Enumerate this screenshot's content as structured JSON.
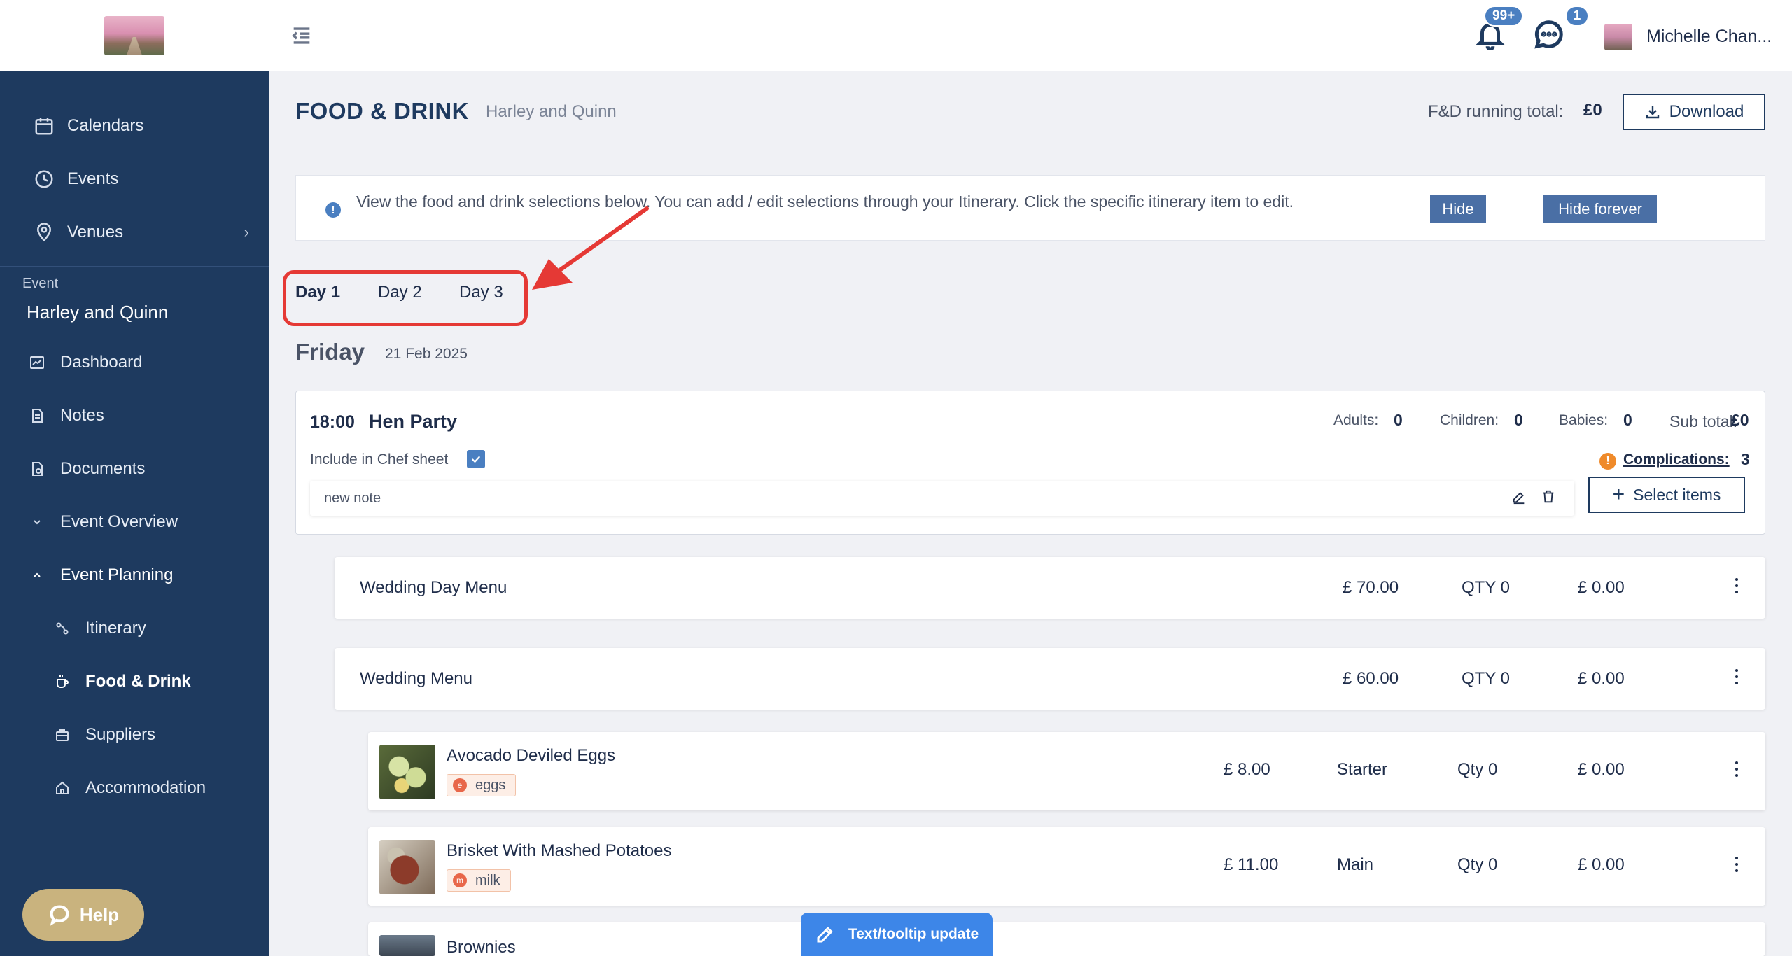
{
  "header": {
    "notifications_badge": "99+",
    "messages_badge": "1",
    "user_name": "Michelle Chan..."
  },
  "sidebar": {
    "top_items": [
      {
        "label": "Calendars",
        "icon": "calendar-icon"
      },
      {
        "label": "Events",
        "icon": "clock-icon"
      },
      {
        "label": "Venues",
        "icon": "location-pin-icon"
      }
    ],
    "event_section_label": "Event",
    "event_name": "Harley and Quinn",
    "event_items": [
      {
        "label": "Dashboard",
        "icon": "chart-icon"
      },
      {
        "label": "Notes",
        "icon": "note-icon"
      },
      {
        "label": "Documents",
        "icon": "document-icon"
      },
      {
        "label": "Event Overview",
        "icon": "chevron-down-icon"
      },
      {
        "label": "Event Planning",
        "icon": "chevron-up-icon"
      }
    ],
    "planning_items": [
      {
        "label": "Itinerary",
        "icon": "route-icon"
      },
      {
        "label": "Food & Drink",
        "icon": "coffee-cup-icon"
      },
      {
        "label": "Suppliers",
        "icon": "briefcase-icon"
      },
      {
        "label": "Accommodation",
        "icon": "home-icon"
      }
    ],
    "help_label": "Help"
  },
  "page": {
    "title": "FOOD & DRINK",
    "subtitle": "Harley and Quinn",
    "running_total_label": "F&D running total:",
    "running_total_value": "£0",
    "download_label": "Download"
  },
  "info_banner": {
    "text": "View the food and drink selections below. You can add / edit selections through your Itinerary. Click the specific itinerary item to edit.",
    "hide_label": "Hide",
    "hide_forever_label": "Hide forever"
  },
  "tabs": [
    {
      "label": "Day 1",
      "active": true
    },
    {
      "label": "Day 2",
      "active": false
    },
    {
      "label": "Day 3",
      "active": false
    }
  ],
  "day": {
    "name": "Friday",
    "date": "21 Feb 2025"
  },
  "event_item": {
    "time": "18:00",
    "title": "Hen Party",
    "adults_label": "Adults:",
    "adults_value": "0",
    "children_label": "Children:",
    "children_value": "0",
    "babies_label": "Babies:",
    "babies_value": "0",
    "subtotal_label": "Sub total:",
    "subtotal_value": "£0",
    "chef_sheet_label": "Include in Chef sheet",
    "chef_sheet_checked": true,
    "complications_label": "Complications:",
    "complications_value": "3",
    "note_text": "new note",
    "select_items_label": "Select items"
  },
  "menus": [
    {
      "name": "Wedding Day Menu",
      "price": "£ 70.00",
      "qty": "QTY 0",
      "total": "£ 0.00"
    },
    {
      "name": "Wedding Menu",
      "price": "£ 60.00",
      "qty": "QTY 0",
      "total": "£ 0.00"
    }
  ],
  "items": [
    {
      "name": "Avocado Deviled Eggs",
      "allergen": "eggs",
      "price": "£ 8.00",
      "course": "Starter",
      "qty": "Qty 0",
      "total": "£ 0.00"
    },
    {
      "name": "Brisket With Mashed Potatoes",
      "allergen": "milk",
      "price": "£ 11.00",
      "course": "Main",
      "qty": "Qty 0",
      "total": "£ 0.00"
    },
    {
      "name": "Brownies"
    }
  ],
  "floating": {
    "tooltip_update_label": "Text/tooltip update"
  },
  "colors": {
    "sidebar_bg": "#1e3a5f",
    "accent_blue": "#4a7fc1",
    "highlight_red": "#e53935",
    "help_gold": "#c9b37e"
  }
}
